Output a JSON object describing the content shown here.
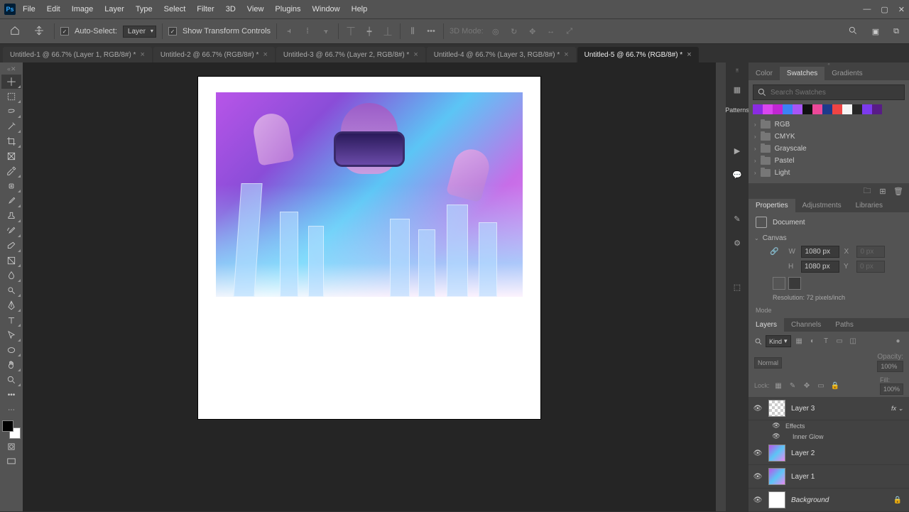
{
  "app": {
    "logo": "Ps"
  },
  "menu": [
    "File",
    "Edit",
    "Image",
    "Layer",
    "Type",
    "Select",
    "Filter",
    "3D",
    "View",
    "Plugins",
    "Window",
    "Help"
  ],
  "options": {
    "auto_select": "Auto-Select:",
    "auto_select_mode": "Layer",
    "show_transform": "Show Transform Controls",
    "mode_3d": "3D Mode:"
  },
  "tabs": [
    {
      "label": "Untitled-1 @ 66.7% (Layer 1, RGB/8#) *",
      "active": false
    },
    {
      "label": "Untitled-2 @ 66.7% (RGB/8#) *",
      "active": false
    },
    {
      "label": "Untitled-3 @ 66.7% (Layer 2, RGB/8#) *",
      "active": false
    },
    {
      "label": "Untitled-4 @ 66.7% (Layer 3, RGB/8#) *",
      "active": false
    },
    {
      "label": "Untitled-5 @ 66.7% (RGB/8#) *",
      "active": true
    }
  ],
  "mid_panel": {
    "patterns": "Patterns"
  },
  "swatches_panel": {
    "tabs": [
      "Color",
      "Swatches",
      "Gradients"
    ],
    "active_tab": "Swatches",
    "search_placeholder": "Search Swatches",
    "colors": [
      "#8a2be2",
      "#d946ef",
      "#c026d3",
      "#3b82f6",
      "#a855f7",
      "#111111",
      "#ec4899",
      "#1e3a8a",
      "#ef4444",
      "#f5f5f5",
      "#262626",
      "#7c3aed",
      "#581c87"
    ],
    "folders": [
      "RGB",
      "CMYK",
      "Grayscale",
      "Pastel",
      "Light"
    ]
  },
  "properties_panel": {
    "tabs": [
      "Properties",
      "Adjustments",
      "Libraries"
    ],
    "active_tab": "Properties",
    "doc_label": "Document",
    "canvas_label": "Canvas",
    "W": "W",
    "H": "H",
    "X": "X",
    "Y": "Y",
    "width": "1080 px",
    "height": "1080 px",
    "x_val": "0 px",
    "y_val": "0 px",
    "resolution": "Resolution: 72 pixels/inch",
    "mode": "Mode"
  },
  "layers_panel": {
    "tabs": [
      "Layers",
      "Channels",
      "Paths"
    ],
    "active_tab": "Layers",
    "kind": "Kind",
    "blend_mode": "Normal",
    "opacity_label": "Opacity:",
    "opacity_val": "100%",
    "lock_label": "Lock:",
    "fill_label": "Fill:",
    "fill_val": "100%",
    "layers": [
      {
        "name": "Layer 3",
        "thumb": "trans",
        "fx": true,
        "effects": [
          "Effects",
          "Inner Glow"
        ]
      },
      {
        "name": "Layer 2",
        "thumb": "img"
      },
      {
        "name": "Layer 1",
        "thumb": "img"
      },
      {
        "name": "Background",
        "thumb": "white",
        "italic": true,
        "locked": true
      }
    ]
  }
}
